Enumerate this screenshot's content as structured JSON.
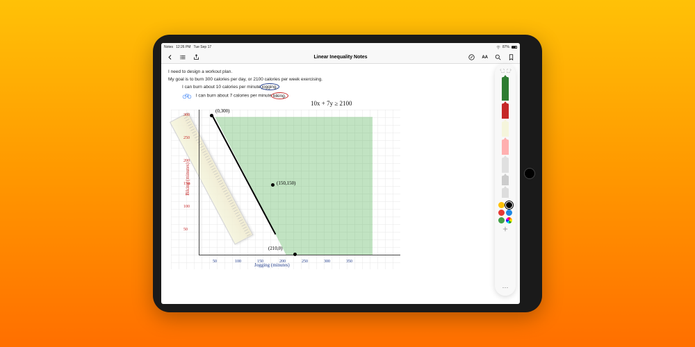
{
  "status": {
    "back_app": "Notes",
    "time": "12:26 PM",
    "date": "Tue Sep 17",
    "battery_pct": "87%"
  },
  "toolbar": {
    "title": "Linear Inequality Notes"
  },
  "note": {
    "line1": "I need to design a workout plan.",
    "line2_pre": "My goal is to burn 300 calories per day, or 2100 calories per week exercising.",
    "bullet1_pre": "I can burn about 10 calories per minute ",
    "bullet1_key": "jogging.",
    "bullet2_pre": "I can burn about 7 calories per minute ",
    "bullet2_key": "biking.",
    "equation": "10x + 7y ≥ 2100"
  },
  "chart_data": {
    "type": "scatter",
    "xlabel": "Jogging (minutes)",
    "ylabel": "Biking (minutes)",
    "x_ticks": [
      50,
      100,
      150,
      200,
      250,
      300,
      350
    ],
    "y_ticks": [
      50,
      100,
      150,
      200,
      250,
      300
    ],
    "points": [
      {
        "x": 0,
        "y": 300,
        "label": "(0,300)"
      },
      {
        "x": 150,
        "y": 150,
        "label": "(150,150)"
      },
      {
        "x": 210,
        "y": 0,
        "label": "(210,0)"
      }
    ],
    "boundary_line": {
      "from": [
        0,
        300
      ],
      "to": [
        210,
        0
      ]
    },
    "shaded": "above-line",
    "xlim": [
      0,
      350
    ],
    "ylim": [
      0,
      300
    ]
  },
  "palette": {
    "tools": [
      {
        "name": "pen",
        "color": "#2e7d32",
        "selected": true
      },
      {
        "name": "marker",
        "color": "#c62828"
      },
      {
        "name": "highlighter",
        "color": "#f5f5dc"
      },
      {
        "name": "pencil",
        "color": "#888"
      },
      {
        "name": "eraser",
        "color": "#e0e0e0"
      },
      {
        "name": "lasso",
        "color": "#bbb"
      },
      {
        "name": "ruler",
        "color": "#ddd"
      }
    ],
    "colors": [
      {
        "name": "yellow",
        "hex": "#ffc107"
      },
      {
        "name": "black",
        "hex": "#000000",
        "selected": true
      },
      {
        "name": "red",
        "hex": "#e53935"
      },
      {
        "name": "blue",
        "hex": "#1e88e5"
      },
      {
        "name": "green",
        "hex": "#43a047"
      }
    ]
  }
}
